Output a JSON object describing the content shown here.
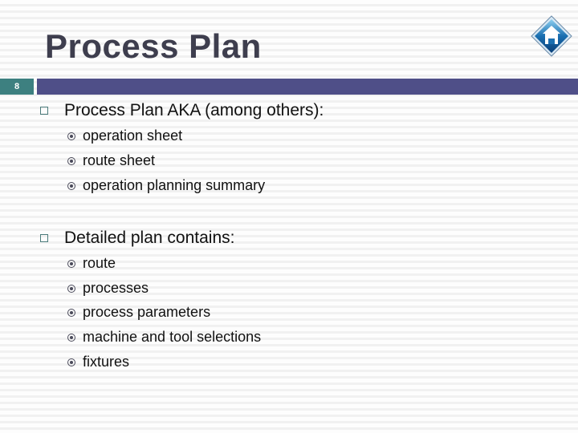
{
  "slide": {
    "title": "Process Plan",
    "number": "8",
    "home_icon": "home-icon",
    "colors": {
      "title": "#3e3e4e",
      "number_band": "#3d8080",
      "title_band": "#4f4f88"
    }
  },
  "sections": [
    {
      "heading": "Process Plan AKA (among others):",
      "items": [
        "operation sheet",
        "route sheet",
        "operation planning summary"
      ]
    },
    {
      "heading": "Detailed plan contains:",
      "items": [
        "route",
        "processes",
        "process parameters",
        "machine and tool selections",
        "fixtures"
      ]
    }
  ]
}
